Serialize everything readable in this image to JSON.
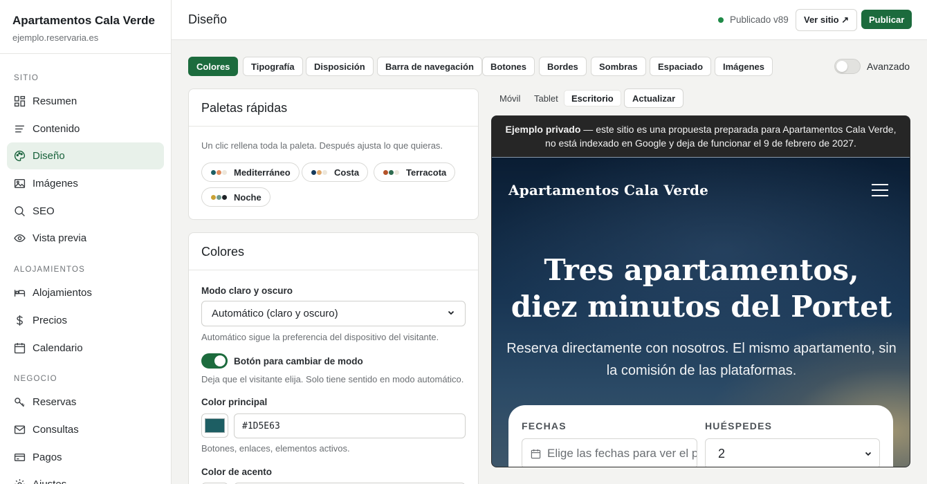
{
  "brand": {
    "title": "Apartamentos Cala Verde",
    "domain": "ejemplo.reservaria.es"
  },
  "sidebar": {
    "sections": [
      "SITIO",
      "ALOJAMIENTOS",
      "NEGOCIO"
    ],
    "items": [
      {
        "label": "Resumen",
        "icon": "grid-icon"
      },
      {
        "label": "Contenido",
        "icon": "lines-icon"
      },
      {
        "label": "Diseño",
        "icon": "palette-icon",
        "active": true
      },
      {
        "label": "Imágenes",
        "icon": "image-icon"
      },
      {
        "label": "SEO",
        "icon": "search-icon"
      },
      {
        "label": "Vista previa",
        "icon": "eye-icon"
      },
      {
        "label": "Alojamientos",
        "icon": "bed-icon"
      },
      {
        "label": "Precios",
        "icon": "dollar-icon"
      },
      {
        "label": "Calendario",
        "icon": "calendar-icon"
      },
      {
        "label": "Reservas",
        "icon": "key-icon"
      },
      {
        "label": "Consultas",
        "icon": "mail-icon"
      },
      {
        "label": "Pagos",
        "icon": "card-icon"
      },
      {
        "label": "Ajustes",
        "icon": "gear-icon"
      }
    ]
  },
  "header": {
    "title": "Diseño",
    "status": "Publicado v89",
    "view_site": "Ver sitio ↗",
    "publish": "Publicar"
  },
  "tabs": [
    "Colores",
    "Tipografía",
    "Disposición",
    "Barra de navegación",
    "Botones",
    "Bordes",
    "Sombras",
    "Espaciado",
    "Imágenes"
  ],
  "advanced_label": "Avanzado",
  "palettes": {
    "title": "Paletas rápidas",
    "hint": "Un clic rellena toda la paleta. Después ajusta lo que quieras.",
    "items": [
      {
        "label": "Mediterráneo",
        "colors": [
          "#1D5E63",
          "#E08A5B",
          "#F4EFE6"
        ]
      },
      {
        "label": "Costa",
        "colors": [
          "#163B5C",
          "#E0A86A",
          "#F2EEE6"
        ]
      },
      {
        "label": "Terracota",
        "colors": [
          "#B4532A",
          "#2F6B4F",
          "#F3ECE2"
        ]
      },
      {
        "label": "Noche",
        "colors": [
          "#C9A236",
          "#6E9A8E",
          "#1E2226"
        ]
      }
    ]
  },
  "colors_card": {
    "title": "Colores",
    "mode_label": "Modo claro y oscuro",
    "mode_value": "Automático (claro y oscuro)",
    "mode_hint": "Automático sigue la preferencia del dispositivo del visitante.",
    "toggle_label": "Botón para cambiar de modo",
    "toggle_hint": "Deja que el visitante elija. Solo tiene sentido en modo automático.",
    "primary_label": "Color principal",
    "primary_value": "#1D5E63",
    "primary_hint": "Botones, enlaces, elementos activos.",
    "accent_label": "Color de acento"
  },
  "devices": [
    "Móvil",
    "Tablet",
    "Escritorio"
  ],
  "refresh_label": "Actualizar",
  "preview": {
    "banner_bold": "Ejemplo privado",
    "banner_text": " — este sitio es una propuesta preparada para Apartamentos Cala Verde, no está indexado en Google y deja de funcionar el 9 de febrero de 2027.",
    "site_name": "Apartamentos Cala Verde",
    "hero_line1": "Tres apartamentos,",
    "hero_line2": "diez minutos del Portet",
    "hero_sub": "Reserva directamente con nosotros. El mismo apartamento, sin la comisión de las plataformas.",
    "dates_label": "FECHAS",
    "dates_placeholder": "Elige las fechas para ver el p...",
    "guests_label": "HUÉSPEDES",
    "guests_value": "2"
  },
  "accent_colors": {
    "brand_green": "#1C6B3D",
    "active_bg": "#E8F1EA"
  }
}
